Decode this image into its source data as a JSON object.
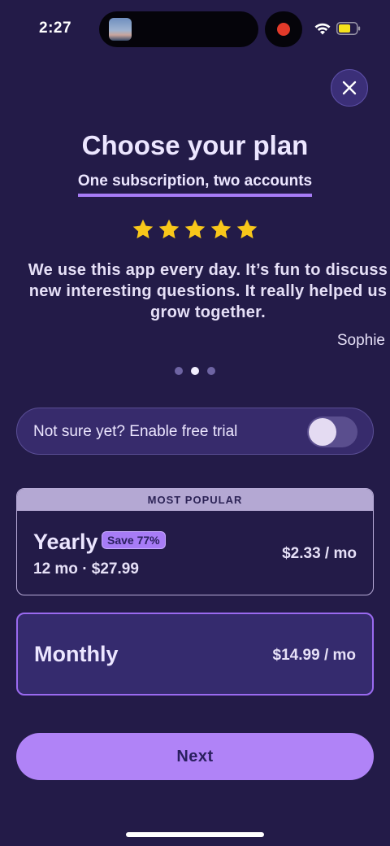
{
  "status_bar": {
    "time": "2:27",
    "icons": [
      "screen-thumbnail-icon",
      "record-icon",
      "wifi-icon",
      "battery-icon"
    ]
  },
  "header": {
    "close_icon": "close-icon",
    "title": "Choose your plan",
    "subtitle": "One subscription, two accounts"
  },
  "review": {
    "rating": 5,
    "rating_max": 5,
    "text": "We use this app every day. It’s fun to discuss new interesting questions. It really helped us grow together.",
    "author": "Sophie",
    "carousel_pages": 3,
    "carousel_active_index": 1
  },
  "trial": {
    "label": "Not sure yet? Enable free trial",
    "enabled": false
  },
  "plans": {
    "yearly": {
      "banner": "MOST POPULAR",
      "name": "Yearly",
      "badge": "Save 77%",
      "detail": "12 mo · $27.99",
      "price": "$2.33 / mo"
    },
    "monthly": {
      "name": "Monthly",
      "price": "$14.99 / mo",
      "selected": true
    }
  },
  "cta": {
    "next_label": "Next"
  },
  "colors": {
    "background": "#231b48",
    "accent": "#b083f7",
    "star": "#f8c71a",
    "selected_border": "#9a6af0"
  }
}
